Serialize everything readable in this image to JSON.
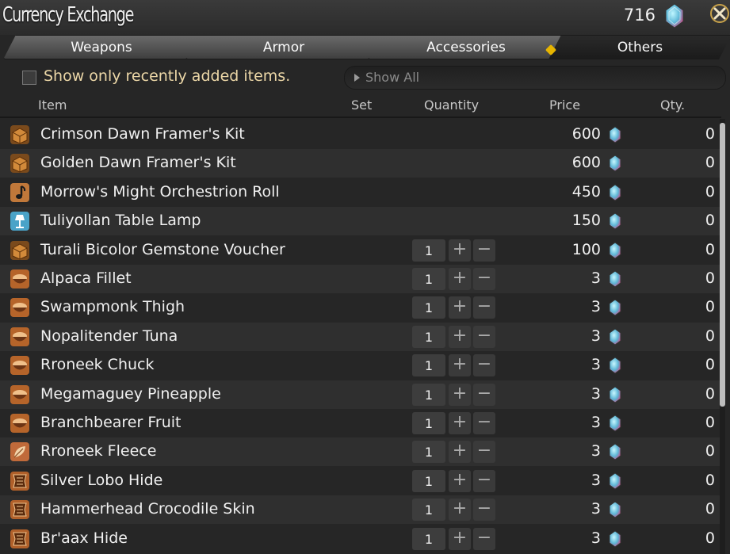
{
  "window": {
    "title": "Currency Exchange",
    "currency_amount": "716"
  },
  "tabs": [
    {
      "label": "Weapons",
      "active": false
    },
    {
      "label": "Armor",
      "active": false
    },
    {
      "label": "Accessories",
      "active": false
    },
    {
      "label": "Others",
      "active": true
    }
  ],
  "filter": {
    "checkbox_label": "Show only recently added items.",
    "checked": false,
    "dropdown_value": "Show All"
  },
  "columns": {
    "item": "Item",
    "set": "Set",
    "quantity": "Quantity",
    "price": "Price",
    "qty": "Qty."
  },
  "colors": {
    "accent": "#e6b400",
    "label": "#ecd7a7",
    "gem": "#e0447e"
  },
  "items": [
    {
      "name": "Crimson Dawn Framer's Kit",
      "icon": "crate-icon",
      "price": "600",
      "qty": "0",
      "has_stepper": false,
      "stepper_value": ""
    },
    {
      "name": "Golden Dawn Framer's Kit",
      "icon": "crate-icon",
      "price": "600",
      "qty": "0",
      "has_stepper": false,
      "stepper_value": ""
    },
    {
      "name": "Morrow's Might Orchestrion Roll",
      "icon": "music-note-icon",
      "price": "450",
      "qty": "0",
      "has_stepper": false,
      "stepper_value": ""
    },
    {
      "name": "Tuliyollan Table Lamp",
      "icon": "lamp-icon",
      "price": "150",
      "qty": "0",
      "has_stepper": false,
      "stepper_value": ""
    },
    {
      "name": "Turali Bicolor Gemstone Voucher",
      "icon": "crate-icon",
      "price": "100",
      "qty": "0",
      "has_stepper": true,
      "stepper_value": "1"
    },
    {
      "name": "Alpaca Fillet",
      "icon": "bowl-icon",
      "price": "3",
      "qty": "0",
      "has_stepper": true,
      "stepper_value": "1"
    },
    {
      "name": "Swampmonk Thigh",
      "icon": "bowl-icon",
      "price": "3",
      "qty": "0",
      "has_stepper": true,
      "stepper_value": "1"
    },
    {
      "name": "Nopalitender Tuna",
      "icon": "bowl-icon",
      "price": "3",
      "qty": "0",
      "has_stepper": true,
      "stepper_value": "1"
    },
    {
      "name": "Rroneek Chuck",
      "icon": "bowl-icon",
      "price": "3",
      "qty": "0",
      "has_stepper": true,
      "stepper_value": "1"
    },
    {
      "name": "Megamaguey Pineapple",
      "icon": "bowl-icon",
      "price": "3",
      "qty": "0",
      "has_stepper": true,
      "stepper_value": "1"
    },
    {
      "name": "Branchbearer Fruit",
      "icon": "bowl-icon",
      "price": "3",
      "qty": "0",
      "has_stepper": true,
      "stepper_value": "1"
    },
    {
      "name": "Rroneek Fleece",
      "icon": "leaf-icon",
      "price": "3",
      "qty": "0",
      "has_stepper": true,
      "stepper_value": "1"
    },
    {
      "name": "Silver Lobo Hide",
      "icon": "hide-icon",
      "price": "3",
      "qty": "0",
      "has_stepper": true,
      "stepper_value": "1"
    },
    {
      "name": "Hammerhead Crocodile Skin",
      "icon": "hide-icon",
      "price": "3",
      "qty": "0",
      "has_stepper": true,
      "stepper_value": "1"
    },
    {
      "name": "Br'aax Hide",
      "icon": "hide-icon",
      "price": "3",
      "qty": "0",
      "has_stepper": true,
      "stepper_value": "1"
    }
  ]
}
